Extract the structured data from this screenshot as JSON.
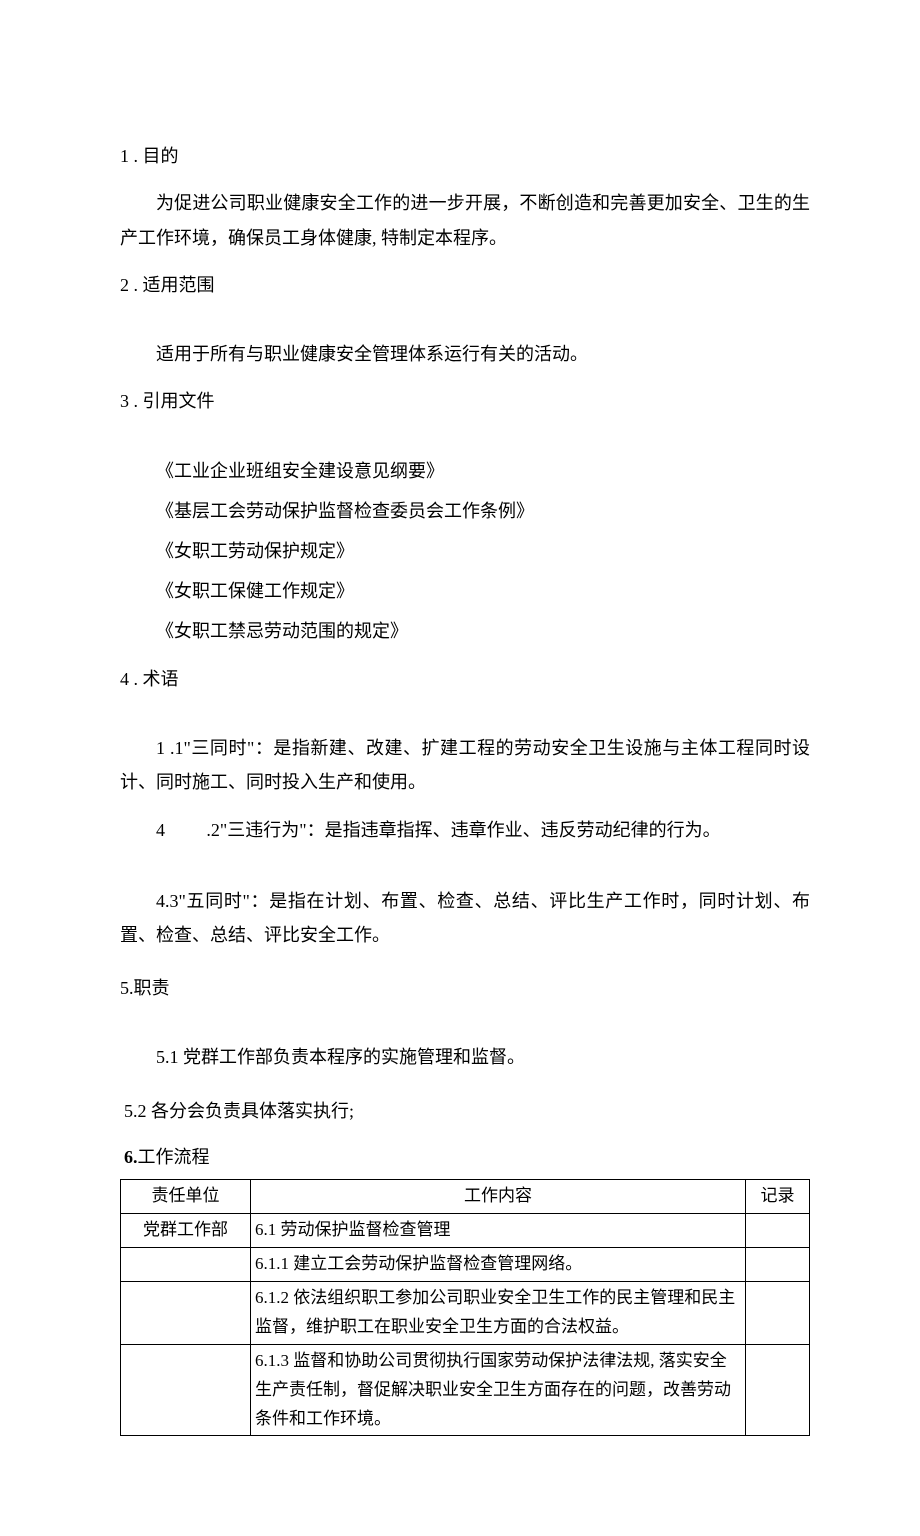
{
  "s1": {
    "heading": "1 . 目的",
    "para": "为促进公司职业健康安全工作的进一步开展，不断创造和完善更加安全、卫生的生产工作环境，确保员工身体健康, 特制定本程序。"
  },
  "s2": {
    "heading": "2 . 适用范围",
    "para": "适用于所有与职业健康安全管理体系运行有关的活动。"
  },
  "s3": {
    "heading": "3 . 引用文件",
    "refs": [
      "《工业企业班组安全建设意见纲要》",
      "《基层工会劳动保护监督检查委员会工作条例》",
      "《女职工劳动保护规定》",
      "《女职工保健工作规定》",
      "《女职工禁忌劳动范围的规定》"
    ]
  },
  "s4": {
    "heading": "4 . 术语",
    "t41": "1 .1\"三同时\"：是指新建、改建、扩建工程的劳动安全卫生设施与主体工程同时设计、同时施工、同时投入生产和使用。",
    "t42num": "4",
    "t42rest": ".2\"三违行为\"：是指违章指挥、违章作业、违反劳动纪律的行为。",
    "t43": "4.3\"五同时\"：是指在计划、布置、检查、总结、评比生产工作时，同时计划、布置、检查、总结、评比安全工作。"
  },
  "s5": {
    "heading": "5.职责",
    "p51": "5.1 党群工作部负责本程序的实施管理和监督。",
    "p52": "5.2 各分会负责具体落实执行;"
  },
  "s6": {
    "heading_bold": "6.",
    "heading_rest": "工作流程",
    "header": {
      "unit": "责任单位",
      "content": "工作内容",
      "record": "记录"
    },
    "rows": [
      {
        "unit": "党群工作部",
        "content": "6.1 劳动保护监督检查管理",
        "record": ""
      },
      {
        "unit": "",
        "content": "6.1.1 建立工会劳动保护监督检查管理网络。",
        "record": ""
      },
      {
        "unit": "",
        "content": "6.1.2 依法组织职工参加公司职业安全卫生工作的民主管理和民主监督，维护职工在职业安全卫生方面的合法权益。",
        "record": ""
      },
      {
        "unit": "",
        "content": "6.1.3 监督和协助公司贯彻执行国家劳动保护法律法规, 落实安全生产责任制，督促解决职业安全卫生方面存在的问题，改善劳动条件和工作环境。",
        "record": ""
      }
    ]
  }
}
